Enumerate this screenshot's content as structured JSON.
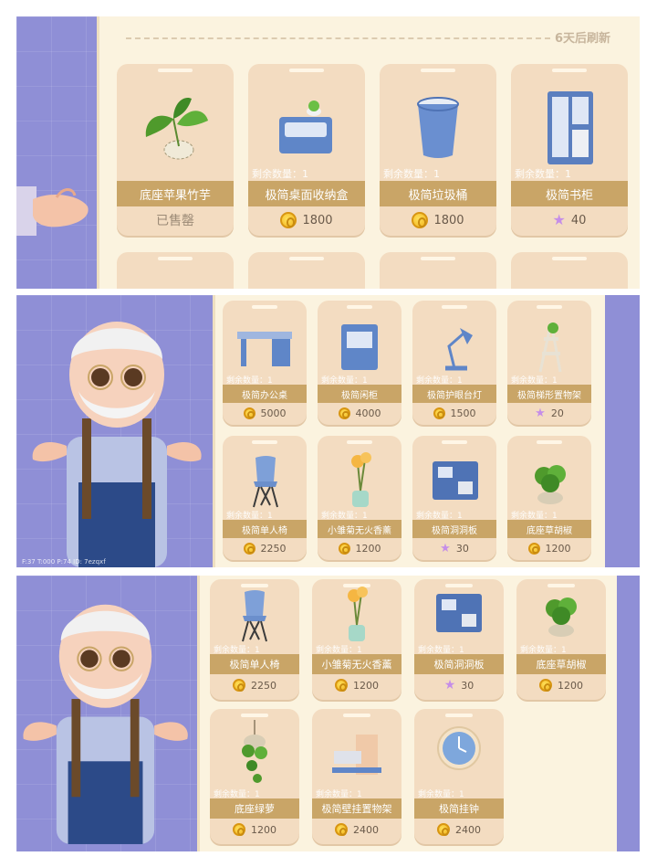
{
  "panel1": {
    "refresh_text": "6天后刷新",
    "items": [
      {
        "name": "底座苹果竹芋",
        "remain": "",
        "price": "",
        "currency": "none",
        "sold": "已售罄"
      },
      {
        "name": "极简桌面收纳盒",
        "remain": "剩余数量：1",
        "price": "1800",
        "currency": "coin",
        "sold": ""
      },
      {
        "name": "极简垃圾桶",
        "remain": "剩余数量：1",
        "price": "1800",
        "currency": "coin",
        "sold": ""
      },
      {
        "name": "极简书柜",
        "remain": "剩余数量：1",
        "price": "40",
        "currency": "star",
        "sold": ""
      }
    ]
  },
  "panel2": {
    "hud_text": "F:37   T:000   P:74   ID: 7ezqxf",
    "items": [
      {
        "name": "极简办公桌",
        "remain": "剩余数量：1",
        "price": "5000",
        "currency": "coin"
      },
      {
        "name": "极简闲柜",
        "remain": "剩余数量：1",
        "price": "4000",
        "currency": "coin"
      },
      {
        "name": "极简护眼台灯",
        "remain": "剩余数量：1",
        "price": "1500",
        "currency": "coin"
      },
      {
        "name": "极简梯形置物架",
        "remain": "剩余数量：1",
        "price": "20",
        "currency": "star"
      },
      {
        "name": "极简单人椅",
        "remain": "剩余数量：1",
        "price": "2250",
        "currency": "coin"
      },
      {
        "name": "小雏菊无火香薰",
        "remain": "剩余数量：1",
        "price": "1200",
        "currency": "coin"
      },
      {
        "name": "极简洞洞板",
        "remain": "剩余数量：1",
        "price": "30",
        "currency": "star"
      },
      {
        "name": "底座草胡椒",
        "remain": "剩余数量：1",
        "price": "1200",
        "currency": "coin"
      }
    ]
  },
  "panel3": {
    "items": [
      {
        "name": "极简单人椅",
        "remain": "剩余数量：1",
        "price": "2250",
        "currency": "coin"
      },
      {
        "name": "小雏菊无火香薰",
        "remain": "剩余数量：1",
        "price": "1200",
        "currency": "coin"
      },
      {
        "name": "极简洞洞板",
        "remain": "剩余数量：1",
        "price": "30",
        "currency": "star"
      },
      {
        "name": "底座草胡椒",
        "remain": "剩余数量：1",
        "price": "1200",
        "currency": "coin"
      },
      {
        "name": "底座绿萝",
        "remain": "剩余数量：1",
        "price": "1200",
        "currency": "coin"
      },
      {
        "name": "极简壁挂置物架",
        "remain": "剩余数量：1",
        "price": "2400",
        "currency": "coin"
      },
      {
        "name": "极简挂钟",
        "remain": "剩余数量：1",
        "price": "2400",
        "currency": "coin"
      }
    ]
  },
  "colors": {
    "purple_bg": "#8f8fd6",
    "shop_bg": "#fbf3df",
    "card": "#f3dcc1",
    "name_band": "#c9a567",
    "coin": "#f1b11c",
    "star": "#c58de8"
  }
}
